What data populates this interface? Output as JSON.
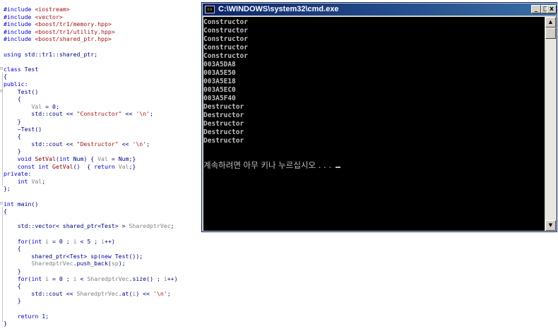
{
  "editor": {
    "lines": [
      [
        [
          "kw",
          "#include "
        ],
        [
          "str",
          "<iostream>"
        ]
      ],
      [
        [
          "kw",
          "#include "
        ],
        [
          "str",
          "<vector>"
        ]
      ],
      [
        [
          "kw",
          "#include "
        ],
        [
          "str",
          "<boost/tr1/memory.hpp>"
        ]
      ],
      [
        [
          "kw",
          "#include "
        ],
        [
          "str",
          "<boost/tr1/utility.hpp>"
        ]
      ],
      [
        [
          "kw",
          "#include "
        ],
        [
          "str",
          "<boost/shared_ptr.hpp>"
        ]
      ],
      [],
      [
        [
          "kw",
          "using "
        ],
        [
          "plain",
          "std::tr1::shared_ptr;"
        ]
      ],
      [],
      [
        [
          "kw",
          "class "
        ],
        [
          "plain",
          "Test"
        ]
      ],
      [
        [
          "plain",
          "{"
        ]
      ],
      [
        [
          "kw",
          "public:"
        ]
      ],
      [
        [
          "plain",
          "    Test()"
        ]
      ],
      [
        [
          "plain",
          "    {"
        ]
      ],
      [
        [
          "plain",
          "        "
        ],
        [
          "id",
          "Val"
        ],
        [
          "plain",
          " = 0;"
        ]
      ],
      [
        [
          "plain",
          "        std::cout << "
        ],
        [
          "str",
          "\"Constructor\""
        ],
        [
          "plain",
          " << "
        ],
        [
          "str",
          "'\\n'"
        ],
        [
          "plain",
          ";"
        ]
      ],
      [
        [
          "plain",
          "    }"
        ]
      ],
      [
        [
          "plain",
          "    ~Test()"
        ]
      ],
      [
        [
          "plain",
          "    {"
        ]
      ],
      [
        [
          "plain",
          "        std::cout << "
        ],
        [
          "str",
          "\"Destructor\""
        ],
        [
          "plain",
          " << "
        ],
        [
          "str",
          "'\\n'"
        ],
        [
          "plain",
          ";"
        ]
      ],
      [
        [
          "plain",
          "    }"
        ]
      ],
      [
        [
          "kw",
          "    void "
        ],
        [
          "fn",
          "SetVal"
        ],
        [
          "plain",
          "("
        ],
        [
          "kw",
          "int "
        ],
        [
          "plain",
          "Num) { "
        ],
        [
          "id",
          "Val"
        ],
        [
          "plain",
          " = Num;}"
        ]
      ],
      [
        [
          "kw",
          "    const int "
        ],
        [
          "fn",
          "GetVal"
        ],
        [
          "plain",
          "()  { "
        ],
        [
          "kw",
          "return "
        ],
        [
          "id",
          "Val"
        ],
        [
          "plain",
          ";}"
        ]
      ],
      [
        [
          "kw",
          "private:"
        ]
      ],
      [
        [
          "kw",
          "    int "
        ],
        [
          "id",
          "Val"
        ],
        [
          "plain",
          ";"
        ]
      ],
      [
        [
          "plain",
          "};"
        ]
      ],
      [],
      [
        [
          "kw",
          "int "
        ],
        [
          "plain",
          "main()"
        ]
      ],
      [
        [
          "plain",
          "{"
        ]
      ],
      [],
      [
        [
          "plain",
          "    std::vector< shared_ptr<Test> > "
        ],
        [
          "id",
          "SharedptrVec"
        ],
        [
          "plain",
          ";"
        ]
      ],
      [],
      [
        [
          "kw",
          "    for"
        ],
        [
          "plain",
          "("
        ],
        [
          "kw",
          "int "
        ],
        [
          "id",
          "i"
        ],
        [
          "plain",
          " = 0 ; "
        ],
        [
          "id",
          "i"
        ],
        [
          "plain",
          " < 5 ; "
        ],
        [
          "id",
          "i"
        ],
        [
          "plain",
          "++)"
        ]
      ],
      [
        [
          "plain",
          "    {"
        ]
      ],
      [
        [
          "plain",
          "        shared_ptr<Test> sp("
        ],
        [
          "kw",
          "new "
        ],
        [
          "plain",
          "Test());"
        ]
      ],
      [
        [
          "plain",
          "        "
        ],
        [
          "id",
          "SharedptrVec"
        ],
        [
          "plain",
          ".push_back("
        ],
        [
          "id",
          "sp"
        ],
        [
          "plain",
          ");"
        ]
      ],
      [
        [
          "plain",
          "    }"
        ]
      ],
      [
        [
          "kw",
          "    for"
        ],
        [
          "plain",
          "("
        ],
        [
          "kw",
          "int "
        ],
        [
          "id",
          "i"
        ],
        [
          "plain",
          " = 0 ; "
        ],
        [
          "id",
          "i"
        ],
        [
          "plain",
          " < "
        ],
        [
          "id",
          "SharedptrVec"
        ],
        [
          "plain",
          ".size() ; "
        ],
        [
          "id",
          "i"
        ],
        [
          "plain",
          "++)"
        ]
      ],
      [
        [
          "plain",
          "    {"
        ]
      ],
      [
        [
          "plain",
          "        std::cout << "
        ],
        [
          "id",
          "SharedptrVec"
        ],
        [
          "plain",
          ".at("
        ],
        [
          "id",
          "i"
        ],
        [
          "plain",
          ") << "
        ],
        [
          "str",
          "'\\n'"
        ],
        [
          "plain",
          ";"
        ]
      ],
      [
        [
          "plain",
          "    }"
        ]
      ],
      [],
      [
        [
          "kw",
          "    return "
        ],
        [
          "plain",
          "1;"
        ]
      ],
      [
        [
          "plain",
          "}"
        ]
      ]
    ]
  },
  "console": {
    "title": "C:\\WINDOWS\\system32\\cmd.exe",
    "icon": "console-app-icon",
    "icon_glyph": "cv",
    "minimize_label": "_",
    "maximize_label": "□",
    "close_label": "x",
    "output_lines": [
      "Constructor",
      "Constructor",
      "Constructor",
      "Constructor",
      "Constructor",
      "003A5DA8",
      "003A5E50",
      "003A5E18",
      "003A5EC0",
      "003A5F40",
      "Destructor",
      "Destructor",
      "Destructor",
      "Destructor",
      "Destructor"
    ],
    "prompt": "계속하려면 아무 키나 누르십시오 . . . ",
    "scroll_up_icon": "▲",
    "scroll_down_icon": "▼"
  }
}
